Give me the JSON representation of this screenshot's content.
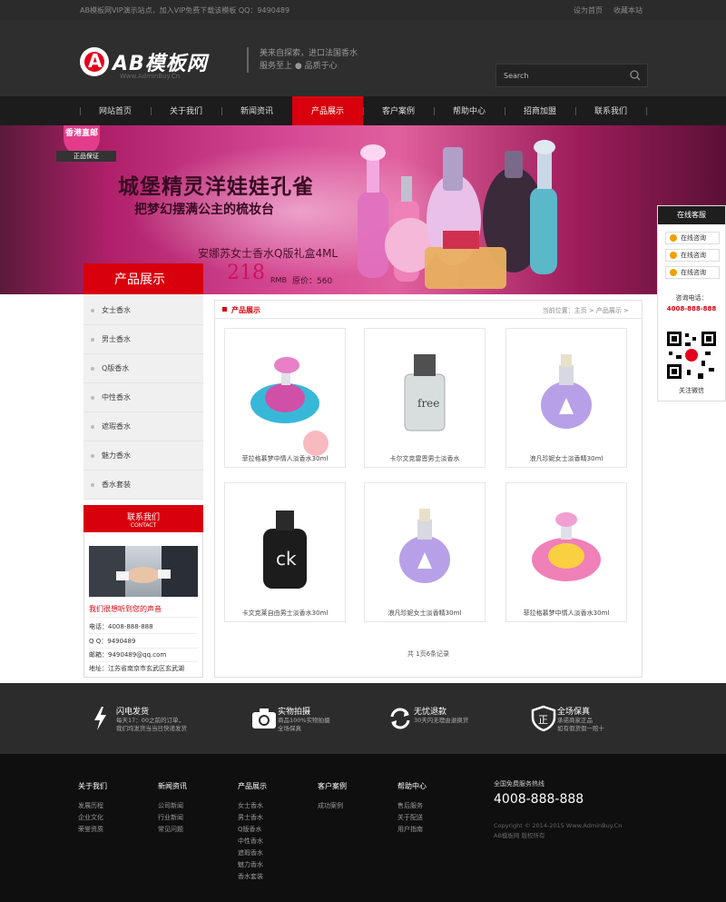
{
  "topbar": {
    "notice": "AB模板网VIP演示站点，加入VIP免费下载该模板 QQ：9490489",
    "set_home": "设为首页",
    "add_fav": "收藏本站"
  },
  "header": {
    "logo_mark": "A",
    "logo_text": "AB模板网",
    "logo_url": "Www.AdminBuy.Cn",
    "slogan_1": "美来自探索，进口法国香水",
    "slogan_2": "服务至上 ● 品质于心",
    "search_placeholder": "Search"
  },
  "nav": {
    "items": [
      {
        "label": "网站首页"
      },
      {
        "label": "关于我们"
      },
      {
        "label": "新闻资讯"
      },
      {
        "label": "产品展示"
      },
      {
        "label": "客户案例"
      },
      {
        "label": "帮助中心"
      },
      {
        "label": "招商加盟"
      },
      {
        "label": "联系我们"
      }
    ],
    "active_index": 3
  },
  "banner": {
    "badge_top": "香港直邮",
    "badge_bottom": "正品保证",
    "title_1": "城堡精灵洋娃娃孔雀",
    "title_2": "把梦幻摆满公主的梳妆台",
    "subtitle": "安娜苏女士香水Q版礼盒4ML",
    "price": "218",
    "price_unit": "RMB",
    "orig_price": "原价：560"
  },
  "sidebar": {
    "title": "产品展示",
    "items": [
      {
        "label": "女士香水"
      },
      {
        "label": "男士香水"
      },
      {
        "label": "Q版香水"
      },
      {
        "label": "中性香水"
      },
      {
        "label": "遮瑕香水"
      },
      {
        "label": "魅力香水"
      },
      {
        "label": "香水套装"
      }
    ]
  },
  "contact": {
    "title": "联系我们",
    "title_en": "CONTACT",
    "tagline": "我们很想听到您的声音",
    "phone": "电话：4008-888-888",
    "qq": "Q Q：9490489",
    "email": "邮箱：9490489@qq.com",
    "address": "地址：江苏省南京市玄武区玄武湖"
  },
  "main": {
    "title": "产品展示",
    "breadcrumb": "当前位置：主页 > 产品展示 >",
    "products": [
      {
        "name": "菲拉格慕梦中情人淡香水30ml"
      },
      {
        "name": "卡尔文克雷恩男士淡香水"
      },
      {
        "name": "浪凡珍妮女士淡香精30ml"
      },
      {
        "name": "卡文克莱自由男士淡香水30ml"
      },
      {
        "name": "浪凡珍妮女士淡香精30ml"
      },
      {
        "name": "菲拉格慕梦中情人淡香水30ml"
      }
    ],
    "pager": "共 1页6条记录"
  },
  "float": {
    "title": "在线客服",
    "btn_1": "在线咨询",
    "btn_2": "在线咨询",
    "btn_3": "在线咨询",
    "tel_label": "咨询电话：",
    "tel": "4008-888-888",
    "qr_label": "关注微信"
  },
  "features": [
    {
      "icon": "lightning-icon",
      "title": "闪电发货",
      "desc_1": "每天17：00之前的订单，",
      "desc_2": "我们均发货当当日快递发货"
    },
    {
      "icon": "camera-icon",
      "title": "实物拍摄",
      "desc_1": "商品100%实物拍摄",
      "desc_2": "全场保真"
    },
    {
      "icon": "refresh-icon",
      "title": "无忧退款",
      "desc_1": "30天内无理由退换货",
      "desc_2": ""
    },
    {
      "icon": "shield-icon",
      "title": "全场保真",
      "desc_1": "承诺商家正品",
      "desc_2": "如有假货假一赔十"
    }
  ],
  "footer": {
    "cols": [
      {
        "title": "关于我们",
        "items": [
          "发展历程",
          "企业文化",
          "荣誉资质"
        ]
      },
      {
        "title": "新闻资讯",
        "items": [
          "公司新闻",
          "行业新闻",
          "常见问题"
        ]
      },
      {
        "title": "产品展示",
        "items": [
          "女士香水",
          "男士香水",
          "Q版香水",
          "中性香水",
          "遮瑕香水",
          "魅力香水",
          "香水套装"
        ]
      },
      {
        "title": "客户案例",
        "items": [
          "成功案例"
        ]
      },
      {
        "title": "帮助中心",
        "items": [
          "售后服务",
          "关于配送",
          "用户指南"
        ]
      }
    ],
    "hotline_label": "全国免费服务热线",
    "hotline": "4008-888-888",
    "copyright": "Copyright © 2014-2015 Www.AdminBuy.Cn",
    "copyright_2": "AB模板网 版权所有"
  },
  "colors": {
    "accent": "#d8000d",
    "header_bg": "#2e2e2e",
    "nav_bg": "#1c1c1c",
    "footer_bg": "#0f0f0f"
  }
}
